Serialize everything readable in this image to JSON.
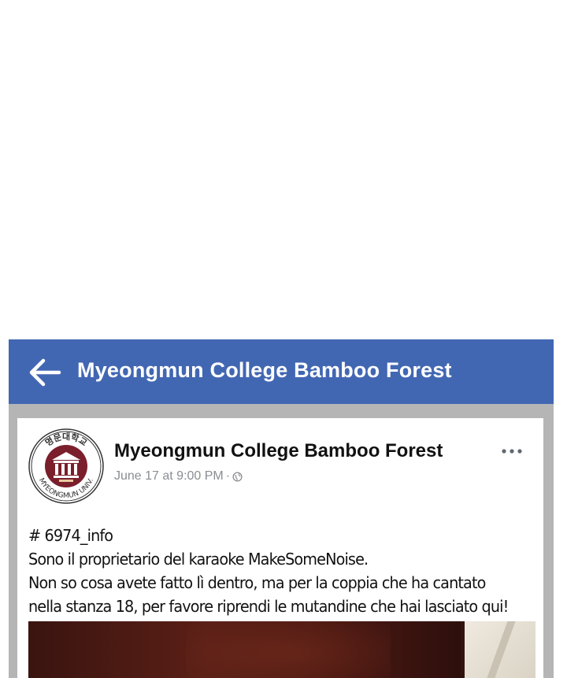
{
  "appbar": {
    "title": "Myeongmun College Bamboo Forest",
    "back_icon": "arrow-left-icon",
    "background": "#4267b2"
  },
  "post": {
    "page_name": "Myeongmun College Bamboo Forest",
    "timestamp": "June 17 at 9:00 PM",
    "separator": "·",
    "audience_icon": "globe-icon",
    "more_icon": "more-horizontal-icon",
    "avatar": {
      "ring_text": "명문대학교",
      "bottom_text": "MYEONGMUN UNIV.",
      "emblem_color": "#7a1f2b"
    },
    "lines": [
      "# 6974_info",
      "Sono il proprietario del karaoke MakeSomeNoise.",
      "Non so cosa avete fatto lì dentro, ma per la coppia che ha cantato",
      "nella stanza 18, per favore riprendi le mutandine che hai lasciato qui!"
    ]
  }
}
